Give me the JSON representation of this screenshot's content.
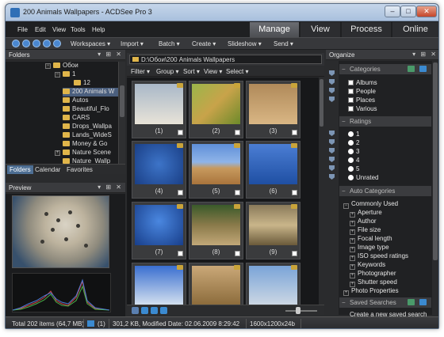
{
  "window": {
    "title": "200 Animals Wallpapers - ACDSee Pro 3"
  },
  "title_buttons": {
    "minimize": "–",
    "maximize": "□",
    "close": "✕"
  },
  "menu": [
    "File",
    "Edit",
    "View",
    "Tools",
    "Help"
  ],
  "modes": [
    {
      "label": "Manage",
      "active": true
    },
    {
      "label": "View",
      "active": false
    },
    {
      "label": "Process",
      "active": false
    },
    {
      "label": "Online",
      "active": false
    }
  ],
  "toolbar": {
    "menus": [
      "Workspaces ▾",
      "Import ▾",
      "Batch ▾",
      "Create ▾",
      "Slideshow ▾",
      "Send ▾"
    ]
  },
  "folders_panel": {
    "title": "Folders",
    "tree": [
      {
        "label": "Обои",
        "level": 0
      },
      {
        "label": "1",
        "level": 1
      },
      {
        "label": "12",
        "level": 2
      },
      {
        "label": "200 Animals W",
        "level": 1,
        "selected": true
      },
      {
        "label": "Autos",
        "level": 1
      },
      {
        "label": "Beautiful_Flo",
        "level": 1
      },
      {
        "label": "CARS",
        "level": 1
      },
      {
        "label": "Drops_Wallpa",
        "level": 1
      },
      {
        "label": "Lands_WideS",
        "level": 1
      },
      {
        "label": "Money & Go",
        "level": 1
      },
      {
        "label": "Nature Scene",
        "level": 1
      },
      {
        "label": "Nature_Wallp",
        "level": 1
      }
    ],
    "tabs": [
      {
        "label": "Folders",
        "active": true
      },
      {
        "label": "Calendar",
        "active": false
      },
      {
        "label": "Favorites",
        "active": false
      }
    ]
  },
  "preview_panel": {
    "title": "Preview"
  },
  "browser": {
    "address": "D:\\Обои\\200 Animals Wallpapers",
    "bar": [
      "Filter ▾",
      "Group ▾",
      "Sort ▾",
      "View ▾",
      "Select ▾"
    ],
    "thumbnails": [
      {
        "caption": "(1)"
      },
      {
        "caption": "(2)"
      },
      {
        "caption": "(3)"
      },
      {
        "caption": "(4)"
      },
      {
        "caption": "(5)"
      },
      {
        "caption": "(6)"
      },
      {
        "caption": "(7)"
      },
      {
        "caption": "(8)"
      },
      {
        "caption": "(9)"
      },
      {
        "caption": ""
      },
      {
        "caption": ""
      },
      {
        "caption": ""
      }
    ]
  },
  "organize": {
    "title": "Organize",
    "categories": {
      "header": "Categories",
      "items": [
        "Albums",
        "People",
        "Places",
        "Various"
      ]
    },
    "ratings": {
      "header": "Ratings",
      "items": [
        "1",
        "2",
        "3",
        "4",
        "5",
        "Unrated"
      ]
    },
    "auto_categories": {
      "header": "Auto Categories",
      "group": "Commonly Used",
      "items": [
        "Aperture",
        "Author",
        "File size",
        "Focal length",
        "Image type",
        "ISO speed ratings",
        "Keywords",
        "Photographer",
        "Shutter speed"
      ],
      "extra": "Photo Properties"
    },
    "saved_searches": {
      "header": "Saved Searches",
      "link": "Create a new saved search"
    }
  },
  "status": {
    "total": "Total 202 items (64,7 MB)",
    "selected": "(1)",
    "info": "301,2 KB, Modified Date: 02.06.2009 8:29:42",
    "dims": "1600x1200x24b"
  },
  "colors": {
    "accent": "#4d6e93",
    "panel": "#2a2b2d",
    "folder": "#e0b54a"
  }
}
